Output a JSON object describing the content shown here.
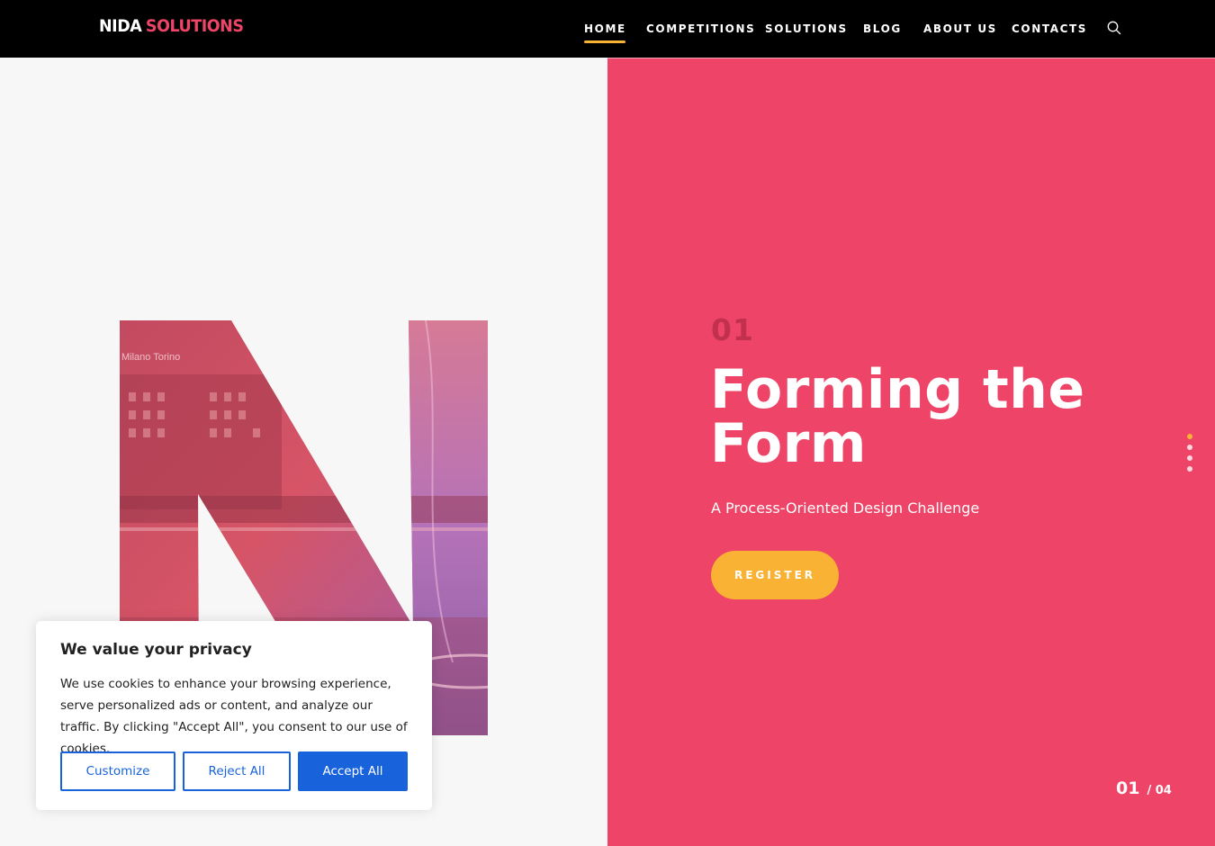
{
  "header": {
    "logo_part1": "NIDA",
    "logo_part2": "SOLUTIONS",
    "nav": [
      {
        "label": "HOME",
        "active": true
      },
      {
        "label": "COMPETITIONS",
        "active": false
      },
      {
        "label": "SOLUTIONS",
        "active": false
      },
      {
        "label": "BLOG",
        "active": false
      },
      {
        "label": "ABOUT US",
        "active": false
      },
      {
        "label": "CONTACTS",
        "active": false
      }
    ],
    "search_icon": "search-icon"
  },
  "hero": {
    "slide_number": "01",
    "title": "Forming the Form",
    "subtitle": "A Process-Oriented Design Challenge",
    "cta_label": "REGISTER",
    "counter_current": "01",
    "counter_total": "/ 04",
    "dots": 4,
    "active_dot": 0,
    "image_text": "Milano Torino"
  },
  "cookie_banner": {
    "title": "We value your privacy",
    "text": "We use cookies to enhance your browsing experience, serve personalized ads or content, and analyze our traffic. By clicking \"Accept All\", you consent to our use of cookies.",
    "customize_label": "Customize",
    "reject_label": "Reject All",
    "accept_label": "Accept All"
  },
  "colors": {
    "accent_pink": "#ee4467",
    "accent_yellow": "#f9b233",
    "cookie_blue": "#1863dc",
    "header_bg": "#000000"
  }
}
